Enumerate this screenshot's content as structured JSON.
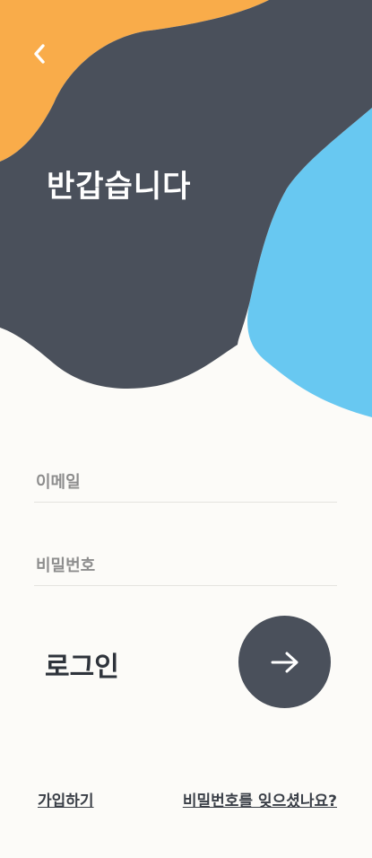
{
  "header": {
    "back_icon": "chevron-left-icon",
    "title": "반갑습니다"
  },
  "form": {
    "email_placeholder": "이메일",
    "email_value": "",
    "password_placeholder": "비밀번호",
    "password_value": "",
    "login_label": "로그인",
    "submit_icon": "arrow-right-icon"
  },
  "links": {
    "signup": "가입하기",
    "forgot_password": "비밀번호를 잊으셨나요?"
  },
  "colors": {
    "background": "#fcfbf8",
    "dark_blob": "#4a505b",
    "orange_blob": "#f9ac4a",
    "blue_blob": "#68c8f1"
  }
}
